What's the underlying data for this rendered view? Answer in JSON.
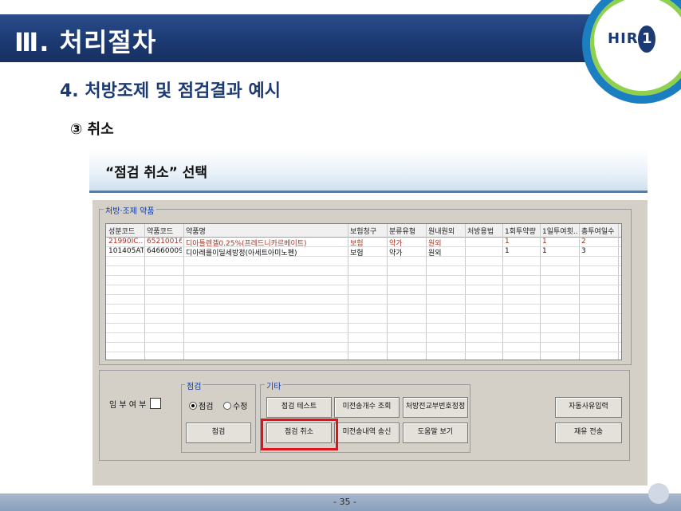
{
  "header": {
    "title": "Ⅲ. 처리절차",
    "logo": "HIRA"
  },
  "section": {
    "heading": "4. 처방조제 및 점검결과 예시",
    "step": "③ 취소"
  },
  "banner": {
    "text": "“점검 취소” 선택"
  },
  "window": {
    "group_label": "처방·조제 약품",
    "columns": [
      "성분코드",
      "약품코드",
      "약품명",
      "보험청구",
      "분류유형",
      "원내원외",
      "처방용법",
      "1회투약량",
      "1일투여횟...",
      "총투여일수"
    ],
    "rows": [
      [
        "21990IC...",
        "652100160",
        "디아틀렌겔0.25%(프레드니카르베이트)",
        "보험",
        "약가",
        "원외",
        "",
        "1",
        "1",
        "2"
      ],
      [
        "101405ATR",
        "646600090",
        "디아레를이딜세방정(아세트아미노펜)",
        "보험",
        "약가",
        "원외",
        "",
        "1",
        "1",
        "3"
      ]
    ],
    "self_pay_label": "임 부 여 부",
    "check_group_label": "점검",
    "radio_check": "점검",
    "radio_edit": "수정",
    "check_button": "점검",
    "etc_group_label": "기타",
    "buttons": {
      "check_test": "점검 테스트",
      "prior_count": "미전송개수 조회",
      "rx_history": "처방전교부번호정정",
      "auto_reason": "자동사유입력",
      "cancel_check": "점검 취소",
      "prior_send": "미전송내역 송신",
      "help": "도움말 보기",
      "resend": "재유 전송"
    }
  },
  "footer": {
    "page": "- 35 -"
  }
}
